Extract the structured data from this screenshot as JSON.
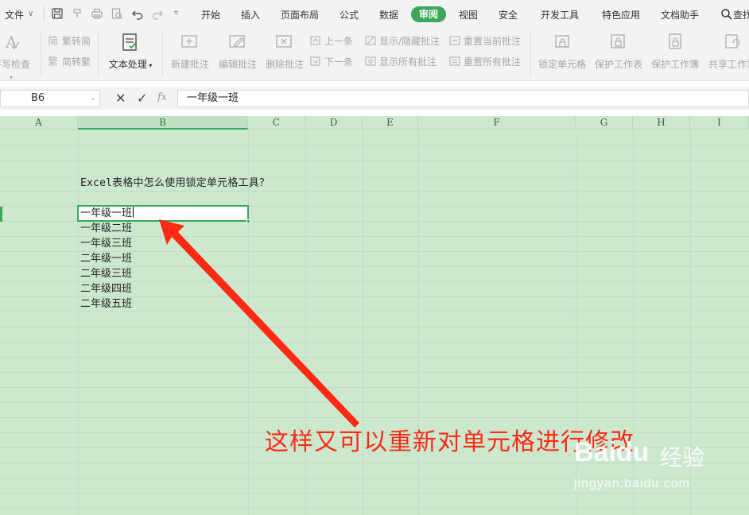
{
  "menubar": {
    "file": "文件",
    "tabs": [
      "开始",
      "插入",
      "页面布局",
      "公式",
      "数据",
      "审阅",
      "视图",
      "安全",
      "开发工具",
      "特色应用",
      "文档助手"
    ],
    "active_tab": "审阅",
    "search": "查找"
  },
  "ribbon": {
    "spell_check": "拼写检查",
    "trad_to_simp": "繁转简",
    "simp_to_trad": "简转繁",
    "text_processing": "文本处理",
    "new_comment": "新建批注",
    "edit_comment": "编辑批注",
    "delete_comment": "删除批注",
    "prev": "上一条",
    "next": "下一条",
    "show_hide_comment": "显示/隐藏批注",
    "show_all_comments": "显示所有批注",
    "reset_current_comment": "重置当前批注",
    "reset_all_comments": "重置所有批注",
    "lock_cell": "锁定单元格",
    "protect_sheet": "保护工作表",
    "protect_workbook": "保护工作簿",
    "share_workbook": "共享工作簿"
  },
  "formula_bar": {
    "name_box": "B6",
    "fx": "fx",
    "value": "一年级一班"
  },
  "sheet": {
    "columns": [
      "A",
      "B",
      "C",
      "D",
      "E",
      "F",
      "G",
      "H",
      "I"
    ],
    "selected_column": "B",
    "title_cell": "Excel表格中怎么使用锁定单元格工具？",
    "active_cell_value": "一年级一班",
    "list": [
      "一年级二班",
      "一年级三班",
      "二年级一班",
      "二年级三班",
      "二年级四班",
      "二年级五班"
    ]
  },
  "annotation": {
    "text": "这样又可以重新对单元格进行修改",
    "color": "#ff2a14"
  },
  "watermark": {
    "logo": "Baidu",
    "brand": "经验",
    "url": "jingyan.baidu.com"
  },
  "colors": {
    "accent": "#3aa859",
    "sheet_bg": "#cce8cf"
  }
}
